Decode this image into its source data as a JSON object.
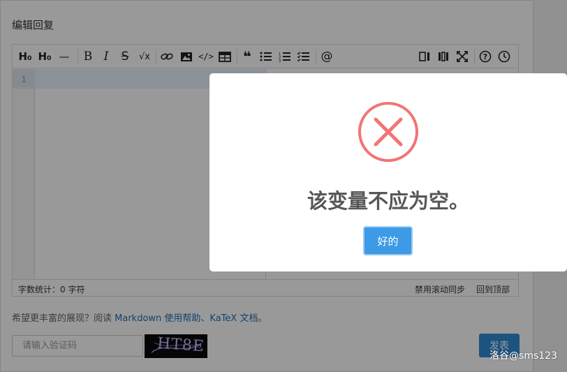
{
  "panel": {
    "title": "编辑回复"
  },
  "toolbar": {
    "heading": "H₀",
    "heading2": "H₀",
    "hr": "—",
    "bold": "B",
    "italic": "I",
    "strike": "S",
    "formula": "√x",
    "code": "</>",
    "quote": "❝",
    "at": "@",
    "help": "?"
  },
  "editor": {
    "line_number": "1"
  },
  "status": {
    "word_count": "字数统计：0 字符",
    "disable_scroll_sync": "禁用滚动同步",
    "back_to_top": "回到顶部"
  },
  "help": {
    "prefix": "希望更丰富的展现？阅读 ",
    "markdown_link": "Markdown 使用帮助",
    "separator": "、",
    "katex_link": "KaTeX 文档",
    "suffix": "。"
  },
  "captcha": {
    "placeholder": "请输入验证码",
    "image_text": "HT8E"
  },
  "publish": {
    "label": "发表"
  },
  "dialog": {
    "title": "该变量不应为空。",
    "ok": "好的"
  },
  "watermark": {
    "text": "洛谷@sms123"
  },
  "colors": {
    "accent": "#3c9ae6",
    "error": "#f27474",
    "link": "#1e6fb5"
  }
}
